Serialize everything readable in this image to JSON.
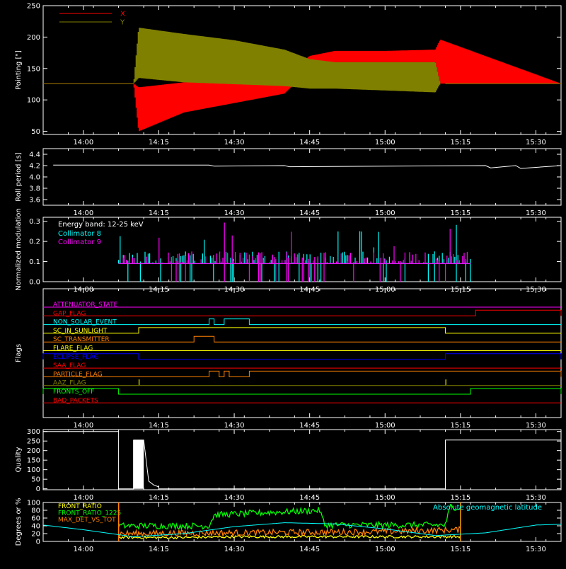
{
  "chart_data": [
    {
      "id": "pointing",
      "type": "line",
      "ylabel": "Pointing [\"]",
      "ylim": [
        45,
        250
      ],
      "yticks": [
        50,
        100,
        150,
        200,
        250
      ],
      "xlim": [
        "13:52",
        "15:35"
      ],
      "xticks": [
        "14:00",
        "14:15",
        "14:30",
        "14:45",
        "15:00",
        "15:15",
        "15:30"
      ],
      "legend_position": "top-left",
      "series": [
        {
          "name": "X",
          "color": "#ff0000",
          "x": [
            "13:52",
            "14:10",
            "14:11",
            "14:20",
            "14:30",
            "14:40",
            "14:45",
            "14:50",
            "15:00",
            "15:10",
            "15:11",
            "15:35"
          ],
          "low": [
            126,
            126,
            50,
            80,
            95,
            110,
            150,
            160,
            160,
            160,
            126,
            126
          ],
          "high": [
            126,
            126,
            120,
            128,
            130,
            138,
            170,
            178,
            178,
            180,
            196,
            126
          ]
        },
        {
          "name": "Y",
          "color": "#808000",
          "x": [
            "13:52",
            "14:10",
            "14:11",
            "14:20",
            "14:30",
            "14:40",
            "14:45",
            "14:50",
            "15:00",
            "15:10",
            "15:11",
            "15:35"
          ],
          "low": [
            126,
            126,
            135,
            128,
            125,
            122,
            118,
            118,
            115,
            112,
            126,
            126
          ],
          "high": [
            126,
            126,
            215,
            205,
            195,
            180,
            165,
            160,
            160,
            160,
            126,
            126
          ]
        }
      ]
    },
    {
      "id": "roll",
      "type": "line",
      "ylabel": "Roll period [s]",
      "ylim": [
        3.5,
        4.5
      ],
      "yticks": [
        3.6,
        3.8,
        4.0,
        4.2,
        4.4
      ],
      "xlim": [
        "13:52",
        "15:35"
      ],
      "xticks": [
        "14:00",
        "14:15",
        "14:30",
        "14:45",
        "15:00",
        "15:15",
        "15:30"
      ],
      "series": [
        {
          "name": "",
          "color": "#ffffff",
          "x": [
            "13:54",
            "14:25",
            "14:26",
            "14:40",
            "14:41",
            "15:20",
            "15:21",
            "15:26",
            "15:27",
            "15:35"
          ],
          "y": [
            4.21,
            4.21,
            4.19,
            4.2,
            4.18,
            4.2,
            4.16,
            4.2,
            4.15,
            4.2
          ]
        }
      ]
    },
    {
      "id": "modulation",
      "type": "line",
      "ylabel": "Normalized modulation",
      "ylim": [
        0,
        0.32
      ],
      "yticks": [
        0.0,
        0.1,
        0.2,
        0.3
      ],
      "xlim": [
        "13:52",
        "15:35"
      ],
      "xticks": [
        "14:00",
        "14:15",
        "14:30",
        "14:45",
        "15:00",
        "15:15",
        "15:30"
      ],
      "annotation": "Energy band: 12-25 keV",
      "series": [
        {
          "name": "Collimator 8",
          "color": "#00ffff",
          "x": [
            "14:07",
            "15:17"
          ],
          "y": [
            0.09,
            0.09
          ],
          "spikes_max": 0.29
        },
        {
          "name": "Collimator 9",
          "color": "#ff00ff",
          "x": [
            "14:07",
            "15:17"
          ],
          "y": [
            0.09,
            0.09
          ],
          "spikes_max": 0.31
        }
      ]
    },
    {
      "id": "flags",
      "type": "line",
      "ylabel": "Flags",
      "xlim": [
        "13:52",
        "15:35"
      ],
      "xticks": [
        "14:00",
        "14:15",
        "14:30",
        "14:45",
        "15:00",
        "15:15",
        "15:30"
      ],
      "flags": [
        {
          "name": "ATTENUATOR_STATE",
          "color": "#ff00ff",
          "segments": []
        },
        {
          "name": "GAP_FLAG",
          "color": "#ff0000",
          "segments": [
            [
              "15:18",
              "15:35"
            ]
          ]
        },
        {
          "name": "NON_SOLAR_EVENT",
          "color": "#00ffff",
          "segments": [
            [
              "14:25",
              "14:26"
            ],
            [
              "14:28",
              "14:33"
            ]
          ]
        },
        {
          "name": "SC_IN_SUNLIGHT",
          "color": "#ffff00",
          "segments": [
            [
              "14:11",
              "15:12"
            ]
          ]
        },
        {
          "name": "SC_TRANSMITTER",
          "color": "#ff8000",
          "segments": [
            [
              "14:22",
              "14:26"
            ]
          ]
        },
        {
          "name": "FLARE_FLAG",
          "color": "#ffff00",
          "segments": []
        },
        {
          "name": "ECLIPSE_FLAG",
          "color": "#0000ff",
          "segments": [
            [
              "13:52",
              "14:11"
            ],
            [
              "15:12",
              "15:35"
            ]
          ]
        },
        {
          "name": "SAA_FLAG",
          "color": "#ff0000",
          "segments": []
        },
        {
          "name": "PARTICLE_FLAG",
          "color": "#ff8000",
          "segments": [
            [
              "14:25",
              "14:27"
            ],
            [
              "14:28",
              "14:29"
            ],
            [
              "14:33",
              "15:35"
            ]
          ]
        },
        {
          "name": "AAZ_FLAG",
          "color": "#808000",
          "segments": [
            [
              "14:11",
              "14:11"
            ],
            [
              "15:12",
              "15:12"
            ]
          ]
        },
        {
          "name": "FRONTS_OFF",
          "color": "#00ff00",
          "segments": [
            [
              "13:52",
              "14:07"
            ],
            [
              "15:17",
              "15:35"
            ]
          ]
        },
        {
          "name": "BAD_PACKETS",
          "color": "#ff0000",
          "segments": []
        }
      ]
    },
    {
      "id": "quality",
      "type": "line",
      "ylabel": "Quality",
      "ylim": [
        -5,
        310
      ],
      "yticks": [
        0,
        50,
        100,
        150,
        200,
        250,
        300
      ],
      "xlim": [
        "13:52",
        "15:35"
      ],
      "xticks": [
        "14:00",
        "14:15",
        "14:30",
        "14:45",
        "15:00",
        "15:15",
        "15:30"
      ],
      "series": [
        {
          "name": "",
          "color": "#ffffff",
          "x": [
            "13:52",
            "14:07",
            "14:07",
            "14:10",
            "14:10",
            "14:11",
            "14:12",
            "14:13",
            "14:14",
            "14:15",
            "14:15",
            "15:12",
            "15:12",
            "15:35"
          ],
          "y": [
            300,
            300,
            0,
            0,
            255,
            255,
            255,
            40,
            20,
            10,
            0,
            0,
            255,
            255
          ]
        }
      ]
    },
    {
      "id": "ratios",
      "type": "line",
      "ylabel": "Degrees or %",
      "ylim": [
        0,
        100
      ],
      "yticks": [
        0,
        20,
        40,
        60,
        80,
        100
      ],
      "xlim": [
        "13:52",
        "15:35"
      ],
      "xticks": [
        "14:00",
        "14:15",
        "14:30",
        "14:45",
        "15:00",
        "15:15",
        "15:30"
      ],
      "annotation": "Absolute geomagnetic latitude",
      "series": [
        {
          "name": "FRONT_RATIO",
          "color": "#ffff00",
          "x": [
            "14:07",
            "14:20",
            "14:30",
            "14:45",
            "15:00",
            "15:15"
          ],
          "y": [
            10,
            10,
            12,
            12,
            12,
            12
          ]
        },
        {
          "name": "FRONT_RATIO_1225",
          "color": "#00ff00",
          "x": [
            "14:07",
            "14:25",
            "14:26",
            "14:47",
            "14:48",
            "15:12",
            "15:13",
            "15:15"
          ],
          "y": [
            40,
            40,
            68,
            80,
            42,
            42,
            90,
            85
          ]
        },
        {
          "name": "MAX_DET_VS_TOT",
          "color": "#ff8000",
          "x": [
            "14:07",
            "14:30",
            "15:00",
            "15:15"
          ],
          "y": [
            20,
            22,
            25,
            30
          ]
        },
        {
          "name": "",
          "color": "#00ffff",
          "x": [
            "13:52",
            "14:00",
            "14:10",
            "14:20",
            "14:30",
            "14:40",
            "14:50",
            "15:00",
            "15:10",
            "15:20",
            "15:30",
            "15:35"
          ],
          "y": [
            42,
            30,
            12,
            20,
            38,
            48,
            45,
            32,
            15,
            22,
            42,
            44
          ]
        }
      ]
    }
  ]
}
